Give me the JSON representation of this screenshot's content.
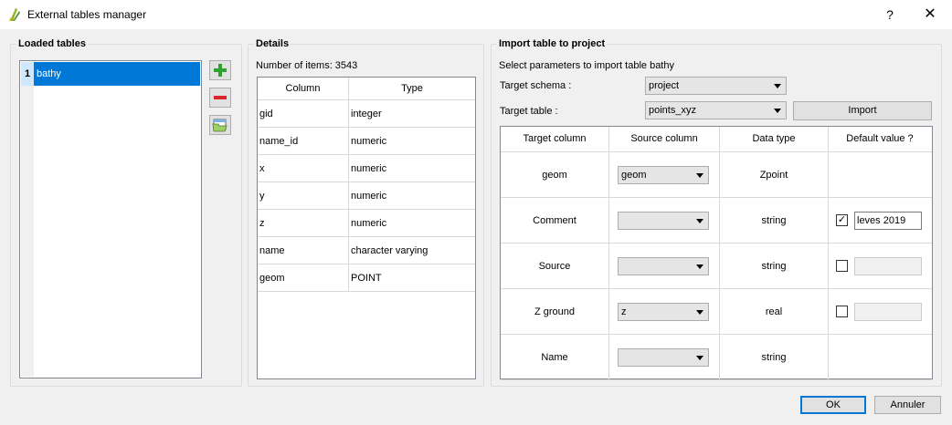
{
  "window": {
    "title": "External tables manager",
    "help": "?",
    "close": "✕"
  },
  "loaded_tables": {
    "title": "Loaded tables",
    "rows": [
      {
        "num": "1",
        "name": "bathy"
      }
    ]
  },
  "details": {
    "title": "Details",
    "count_label": "Number of items: 3543",
    "headers": [
      "Column",
      "Type"
    ],
    "rows": [
      [
        "gid",
        "integer"
      ],
      [
        "name_id",
        "numeric"
      ],
      [
        "x",
        "numeric"
      ],
      [
        "y",
        "numeric"
      ],
      [
        "z",
        "numeric"
      ],
      [
        "name",
        "character varying"
      ],
      [
        "geom",
        "POINT"
      ]
    ]
  },
  "import": {
    "title": "Import table to project",
    "instruction": "Select parameters to import table bathy",
    "schema_label": "Target schema :",
    "schema_value": "project",
    "table_label": "Target table :",
    "table_value": "points_xyz",
    "import_button": "Import",
    "mapping_headers": [
      "Target column",
      "Source column",
      "Data type",
      "Default value ?"
    ],
    "mapping_rows": [
      {
        "target": "geom",
        "source": "geom",
        "type": "Zpoint",
        "has_default": false
      },
      {
        "target": "Comment",
        "source": "",
        "type": "string",
        "has_default": true,
        "checked": true,
        "check_mark": "✓",
        "default": "leves 2019"
      },
      {
        "target": "Source",
        "source": "",
        "type": "string",
        "has_default": true,
        "checked": false,
        "default": ""
      },
      {
        "target": "Z ground",
        "source": "z",
        "type": "real",
        "has_default": true,
        "checked": false,
        "default": ""
      },
      {
        "target": "Name",
        "source": "",
        "type": "string",
        "has_default": false
      }
    ]
  },
  "footer": {
    "ok": "OK",
    "cancel": "Annuler"
  },
  "colors": {
    "selection": "#0078d7",
    "add": "#2ea12e",
    "remove": "#d9262b"
  }
}
